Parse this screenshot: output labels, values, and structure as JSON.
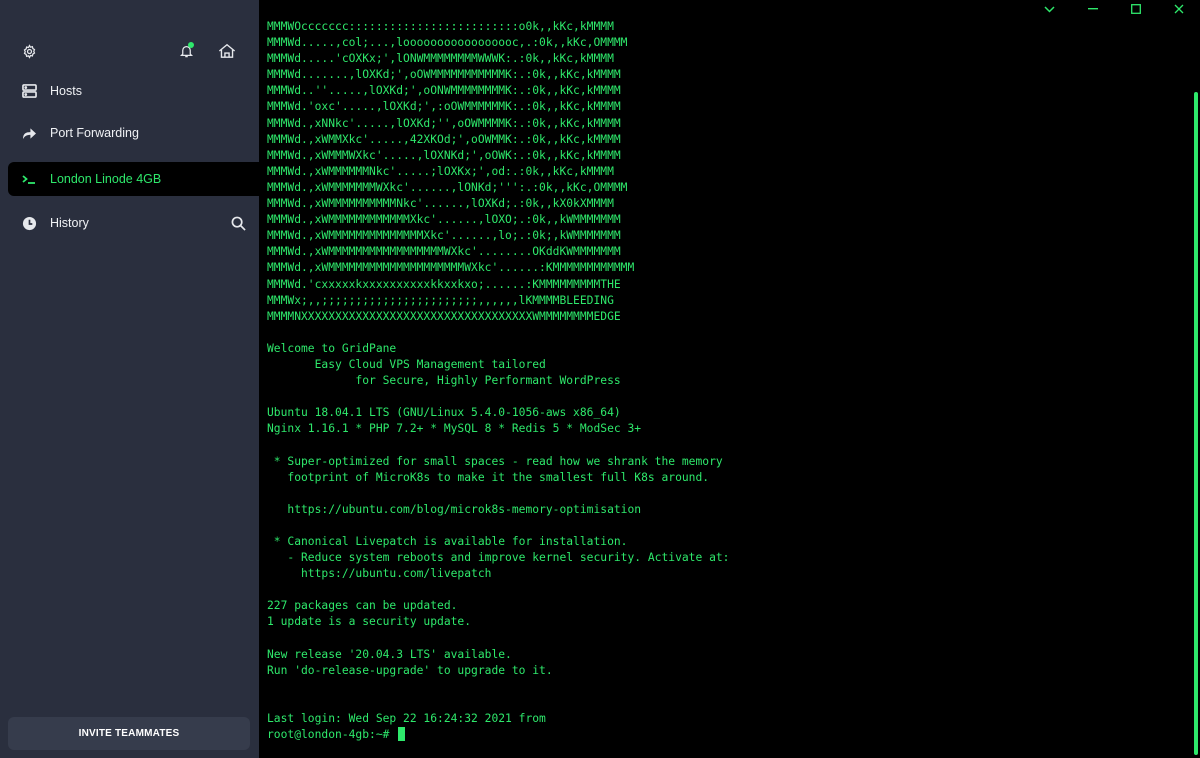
{
  "colors": {
    "sidebar_bg": "#2a2f3e",
    "accent_green": "#2ee86b",
    "terminal_bg": "#000000",
    "invite_bg": "#363c4c"
  },
  "top_icons": {
    "settings": "gear-icon",
    "notifications": "bell-icon",
    "home": "home-icon"
  },
  "sidebar": {
    "items": [
      {
        "label": "Hosts",
        "icon": "server-icon"
      },
      {
        "label": "Port Forwarding",
        "icon": "forward-arrow-icon"
      },
      {
        "label": "London Linode 4GB",
        "icon": "terminal-prompt-icon",
        "active": true
      },
      {
        "label": "History",
        "icon": "clock-icon"
      }
    ],
    "history_search_icon": "search-icon",
    "invite_label": "INVITE TEAMMATES"
  },
  "window_controls": [
    "chevron-down-icon",
    "minimize-icon",
    "maximize-icon",
    "close-icon"
  ],
  "terminal": {
    "lines": [
      "MMMWOccccccc:::::::::::::::::::::::::o0k,,kKc,kMMMM",
      "MMMWd.....,col;...,looooooooooooooooc,.:0k,,kKc,OMMMM",
      "MMMWd.....'cOXKx;',lONWMMMMMMMMWWWK:.:0k,,kKc,kMMMM",
      "MMMWd.......,lOXKd;',oOWMMMMMMMMMMMK:.:0k,,kKc,kMMMM",
      "MMMWd..''.....,lOXKd;',oONWMMMMMMMMK:.:0k,,kKc,kMMMM",
      "MMMWd.'oxc'.....,lOXKd;',:oOWMMMMMMK:.:0k,,kKc,kMMMM",
      "MMMWd.,xNNkc'.....,lOXKd;'',oOWMMMMK:.:0k,,kKc,kMMMM",
      "MMMWd.,xWMMXkc'.....,42XKOd;',oOWMMK:.:0k,,kKc,kMMMM",
      "MMMWd.,xWMMMWXkc'.....,lOXNKd;',oOWK:.:0k,,kKc,kMMMM",
      "MMMWd.,xWMMMMMMNkc'.....;lOXKx;',od:.:0k,,kKc,kMMMM",
      "MMMWd.,xWMMMMMMMWXkc'......,lONKd;''':.:0k,,kKc,OMMMM",
      "MMMWd.,xWMMMMMMMMMMNkc'......,lOXKd;.:0k,,kX0kXMMMM",
      "MMMWd.,xWMMMMMMMMMMMMXkc'......,lOXO;.:0k,,kWMMMMMMM",
      "MMMWd.,xWMMMMMMMMMMMMMMXkc'......,lo;.:0k;,kWMMMMMMM",
      "MMMWd.,xWMMMMMMMMMMMMMMMMMWXkc'........OKddKWMMMMMMM",
      "MMMWd.,xWMMMMMMMMMMMMMMMMMMMMWXkc'......:KMMMMMMMMMMMM",
      "MMMWd.'cxxxxxkxxxxxxxxxxkkxxkxo;......:KMMMMMMMMMTHE",
      "MMMWx;,,;;;;;;;;;;;;;;;;;;;;;;;,,,,,,lKMMMMBLEEDING",
      "MMMMNXXXXXXXXXXXXXXXXXXXXXXXXXXXXXXXXXXWMMMMMMMMEDGE",
      "",
      "Welcome to GridPane",
      "       Easy Cloud VPS Management tailored",
      "             for Secure, Highly Performant WordPress",
      "",
      "Ubuntu 18.04.1 LTS (GNU/Linux 5.4.0-1056-aws x86_64)",
      "Nginx 1.16.1 * PHP 7.2+ * MySQL 8 * Redis 5 * ModSec 3+",
      "",
      " * Super-optimized for small spaces - read how we shrank the memory",
      "   footprint of MicroK8s to make it the smallest full K8s around.",
      "",
      "   https://ubuntu.com/blog/microk8s-memory-optimisation",
      "",
      " * Canonical Livepatch is available for installation.",
      "   - Reduce system reboots and improve kernel security. Activate at:",
      "     https://ubuntu.com/livepatch",
      "",
      "227 packages can be updated.",
      "1 update is a security update.",
      "",
      "New release '20.04.3 LTS' available.",
      "Run 'do-release-upgrade' to upgrade to it.",
      "",
      "",
      "Last login: Wed Sep 22 16:24:32 2021 from"
    ],
    "prompt": "root@london-4gb:~# "
  }
}
